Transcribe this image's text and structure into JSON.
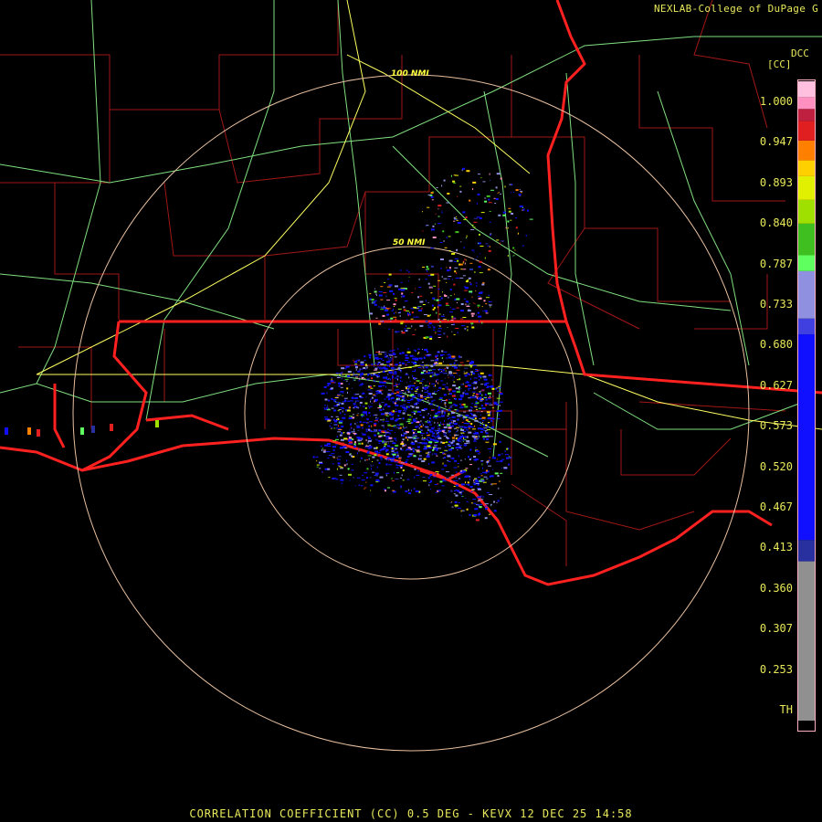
{
  "credit": "NEXLAB-College of DuPage G",
  "station_id": "DCC",
  "unit": "[CC]",
  "footer": "CORRELATION COEFFICIENT (CC) 0.5 DEG - KEVX 12 DEC 25 14:58",
  "range_rings": [
    {
      "label": "50 NMI"
    },
    {
      "label": "100 NMI"
    }
  ],
  "colors": {
    "background": "#000000",
    "state_border": "#ff2020",
    "county_border": "#a01818",
    "highway_interstate": "#ffff60",
    "highway_us": "#80e080",
    "range_ring": "#e8c0a0",
    "label_text": "#e8e85a"
  },
  "legend": {
    "ticks": [
      "1.000",
      "0.947",
      "0.893",
      "0.840",
      "0.787",
      "0.733",
      "0.680",
      "0.627",
      "0.573",
      "0.520",
      "0.467",
      "0.413",
      "0.360",
      "0.307",
      "0.253",
      "TH"
    ],
    "scale": [
      {
        "from": 0.2,
        "to": 0.413,
        "color": "#909090"
      },
      {
        "from": 0.413,
        "to": 0.44,
        "color": "#2830a0"
      },
      {
        "from": 0.44,
        "to": 0.7,
        "color": "#1010ff"
      },
      {
        "from": 0.7,
        "to": 0.72,
        "color": "#4040e0"
      },
      {
        "from": 0.72,
        "to": 0.78,
        "color": "#9090e0"
      },
      {
        "from": 0.78,
        "to": 0.8,
        "color": "#60ff60"
      },
      {
        "from": 0.8,
        "to": 0.84,
        "color": "#40c020"
      },
      {
        "from": 0.84,
        "to": 0.87,
        "color": "#a0e000"
      },
      {
        "from": 0.87,
        "to": 0.9,
        "color": "#e0f000"
      },
      {
        "from": 0.9,
        "to": 0.92,
        "color": "#ffd000"
      },
      {
        "from": 0.92,
        "to": 0.945,
        "color": "#ff8000"
      },
      {
        "from": 0.945,
        "to": 0.97,
        "color": "#e02020"
      },
      {
        "from": 0.97,
        "to": 0.985,
        "color": "#c02040"
      },
      {
        "from": 0.985,
        "to": 1.0,
        "color": "#ff90c0"
      },
      {
        "from": 1.0,
        "to": 1.02,
        "color": "#ffc0e0"
      }
    ]
  }
}
